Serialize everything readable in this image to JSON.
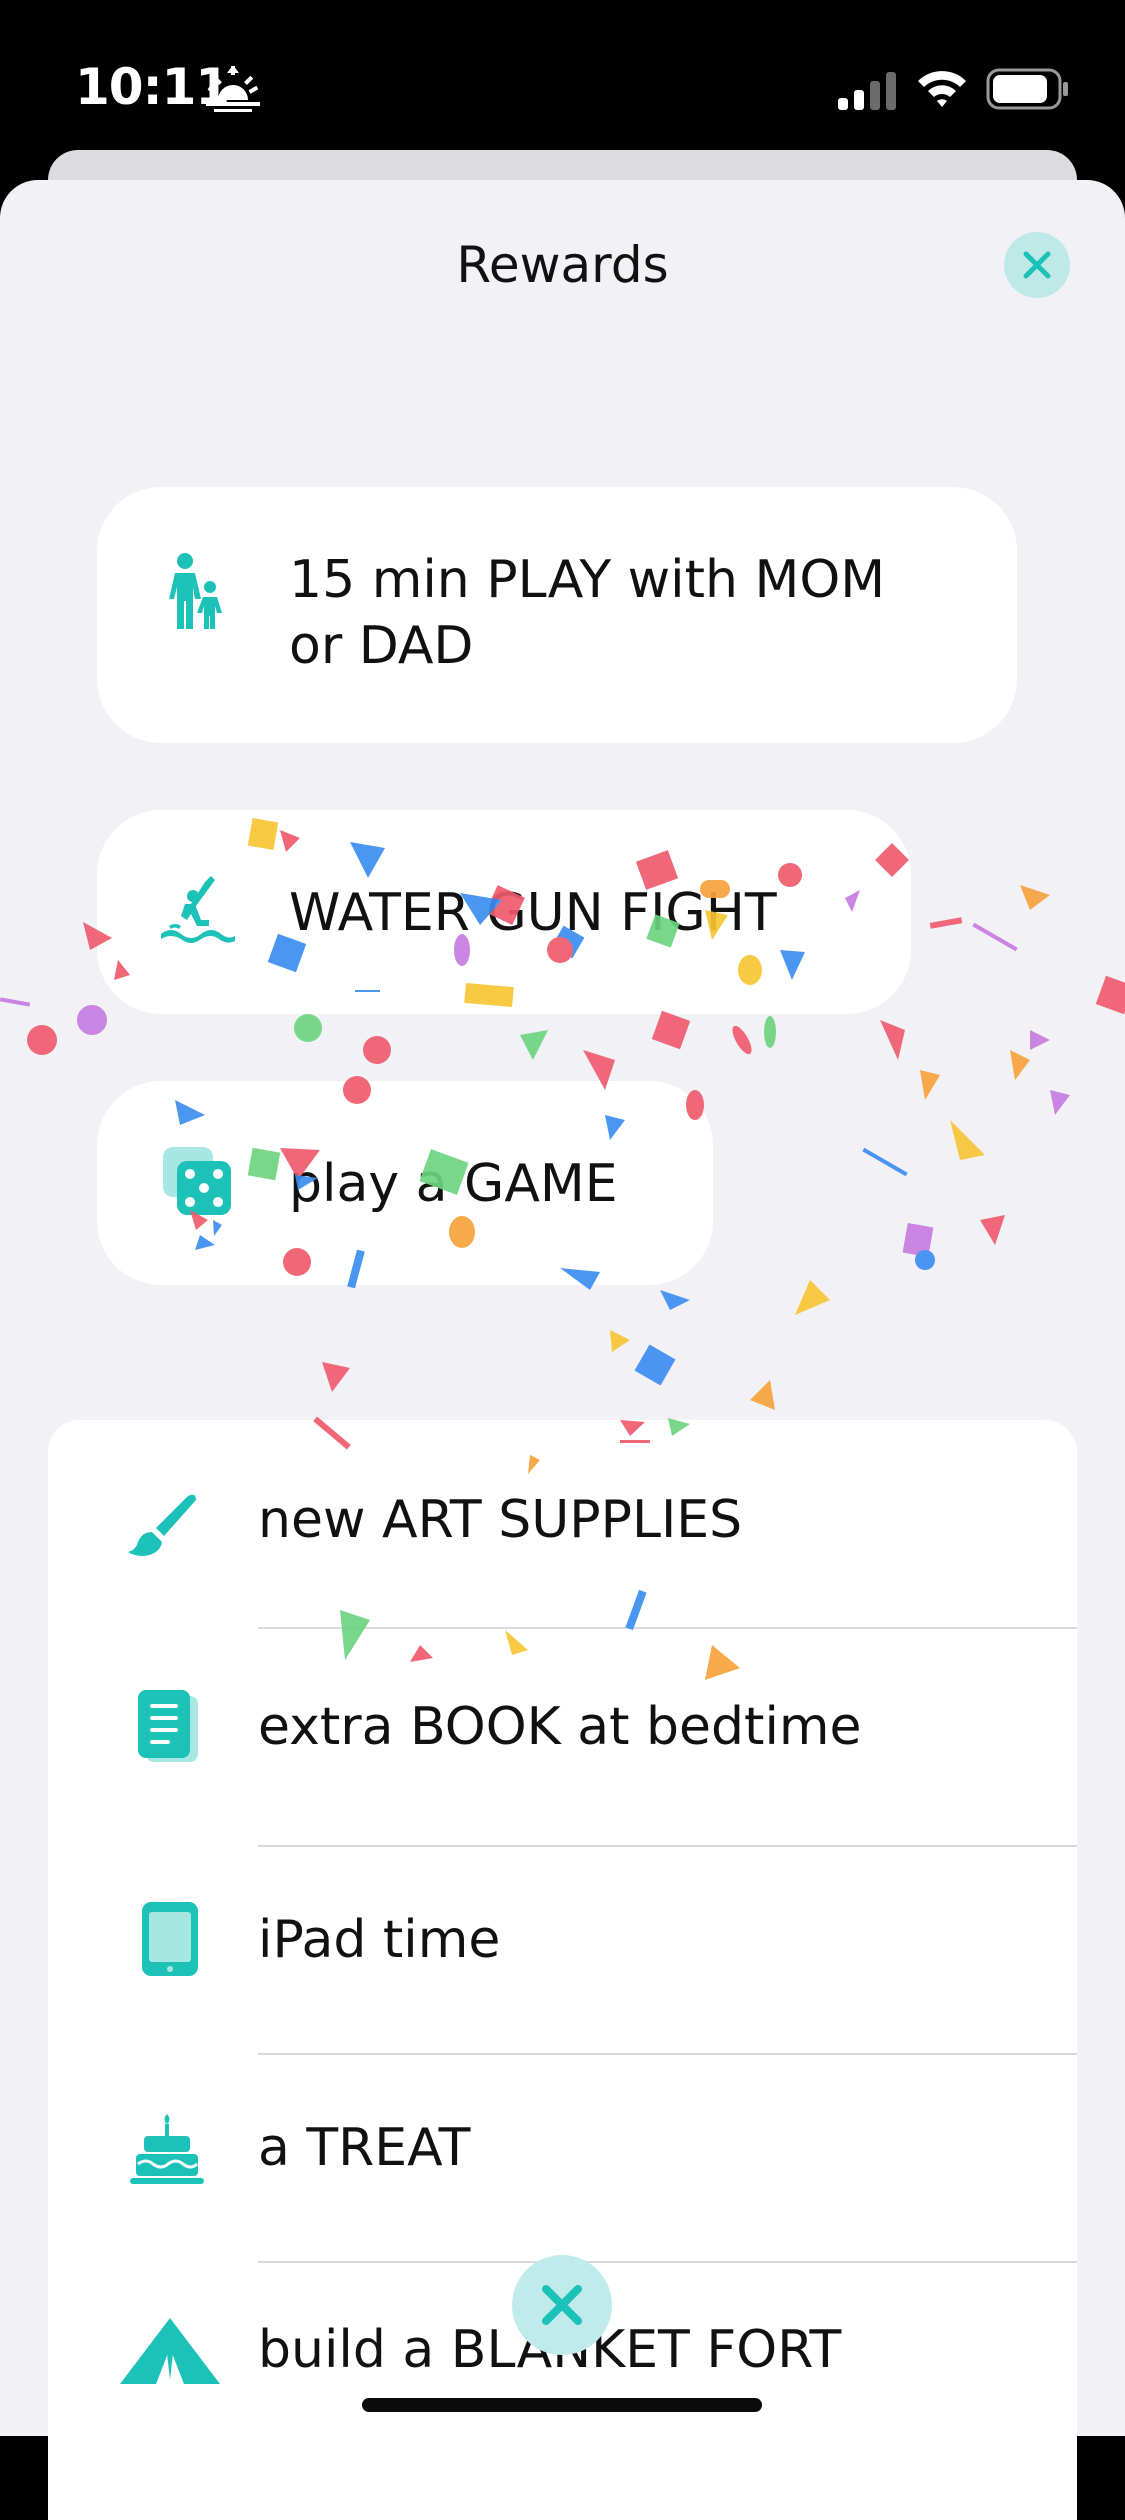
{
  "status_bar": {
    "time": "10:11",
    "icons": [
      "sunrise-icon",
      "signal-icon",
      "wifi-icon",
      "battery-icon"
    ]
  },
  "header": {
    "title": "Rewards",
    "close_icon": "close-icon"
  },
  "featured_rewards": [
    {
      "label_line1": "15 min PLAY with MOM",
      "label_line2": "or DAD",
      "icon": "parent-child-icon"
    },
    {
      "label": "WATER GUN FIGHT",
      "icon": "water-slide-icon"
    },
    {
      "label": "play a GAME",
      "icon": "dice-icon"
    }
  ],
  "reward_list": [
    {
      "label": "new ART SUPPLIES",
      "icon": "paintbrush-icon"
    },
    {
      "label": "extra BOOK at bedtime",
      "icon": "book-icon"
    },
    {
      "label": "iPad time",
      "icon": "tablet-icon"
    },
    {
      "label": "a TREAT",
      "icon": "cake-icon"
    },
    {
      "label": "build a BLANKET FORT",
      "icon": "tent-icon"
    }
  ],
  "colors": {
    "accent": "#1cc2b8",
    "accent_light": "#bfe9e7",
    "sheet_background": "#f1f1f6",
    "card_background": "#ffffff"
  }
}
